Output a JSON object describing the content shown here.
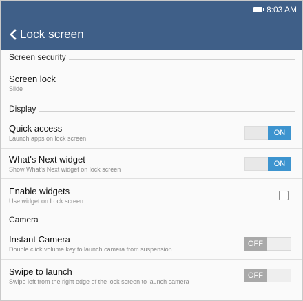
{
  "status": {
    "time": "8:03 AM",
    "battery_icon": "battery-icon"
  },
  "colors": {
    "header_bg": "#3f5f88",
    "toggle_on": "#3d94cf",
    "toggle_off": "#a9a9a9"
  },
  "appbar": {
    "back_icon": "chevron-left-icon",
    "title": "Lock screen"
  },
  "sections": {
    "screen_security": "Screen security",
    "display": "Display",
    "camera": "Camera"
  },
  "items": {
    "screen_lock": {
      "title": "Screen lock",
      "subtitle": "Slide"
    },
    "quick_access": {
      "title": "Quick access",
      "subtitle": "Launch apps on lock screen",
      "state": "ON"
    },
    "whats_next": {
      "title": "What's Next widget",
      "subtitle": "Show What's Next widget on lock screen",
      "state": "ON"
    },
    "enable_widgets": {
      "title": "Enable widgets",
      "subtitle": "Use widget on Lock screen",
      "checked": false
    },
    "instant_camera": {
      "title": "Instant Camera",
      "subtitle": "Double click volume key to launch camera from suspension",
      "state": "OFF"
    },
    "swipe_to_launch": {
      "title": "Swipe to launch",
      "subtitle": "Swipe left from the right edge of the lock screen to launch camera",
      "state": "OFF"
    }
  }
}
